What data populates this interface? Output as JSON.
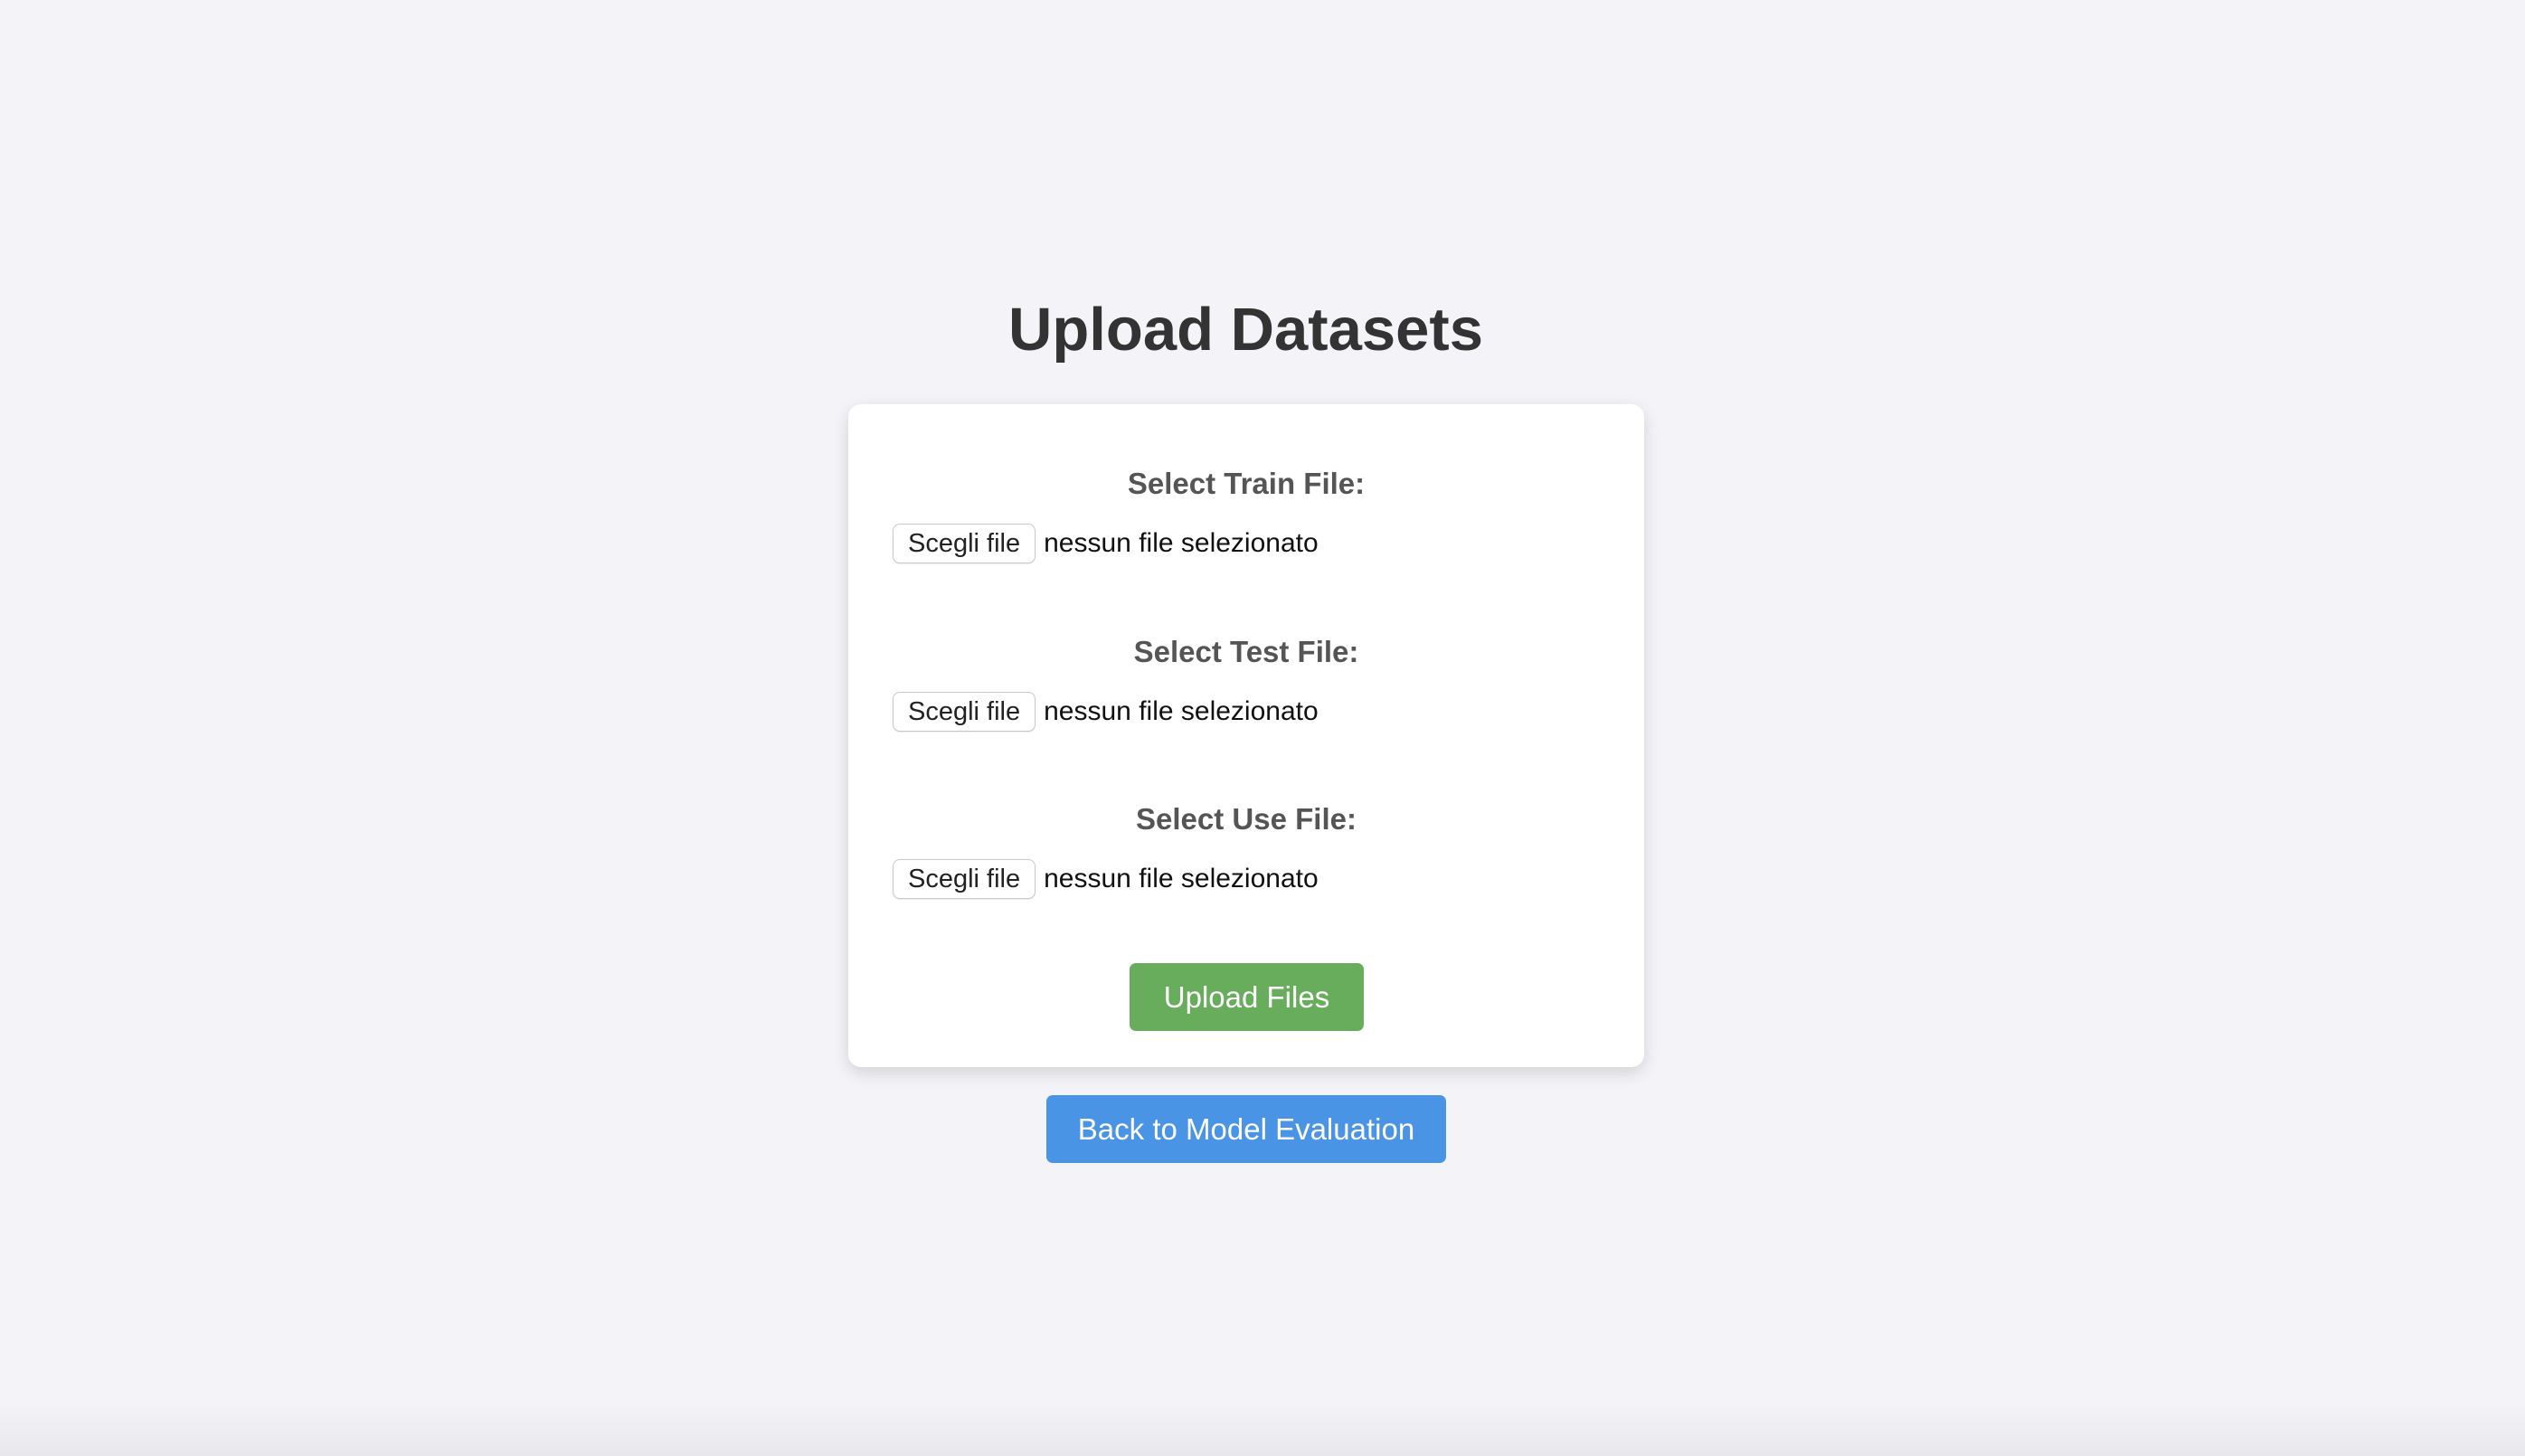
{
  "page": {
    "title": "Upload Datasets"
  },
  "form": {
    "fields": [
      {
        "label": "Select Train File:",
        "button": "Scegli file",
        "status": "nessun file selezionato"
      },
      {
        "label": "Select Test File:",
        "button": "Scegli file",
        "status": "nessun file selezionato"
      },
      {
        "label": "Select Use File:",
        "button": "Scegli file",
        "status": "nessun file selezionato"
      }
    ],
    "submit_label": "Upload Files"
  },
  "nav": {
    "back_label": "Back to Model Evaluation"
  },
  "colors": {
    "background": "#f4f4f8",
    "submit": "#67ad5b",
    "back": "#4a94e6"
  }
}
